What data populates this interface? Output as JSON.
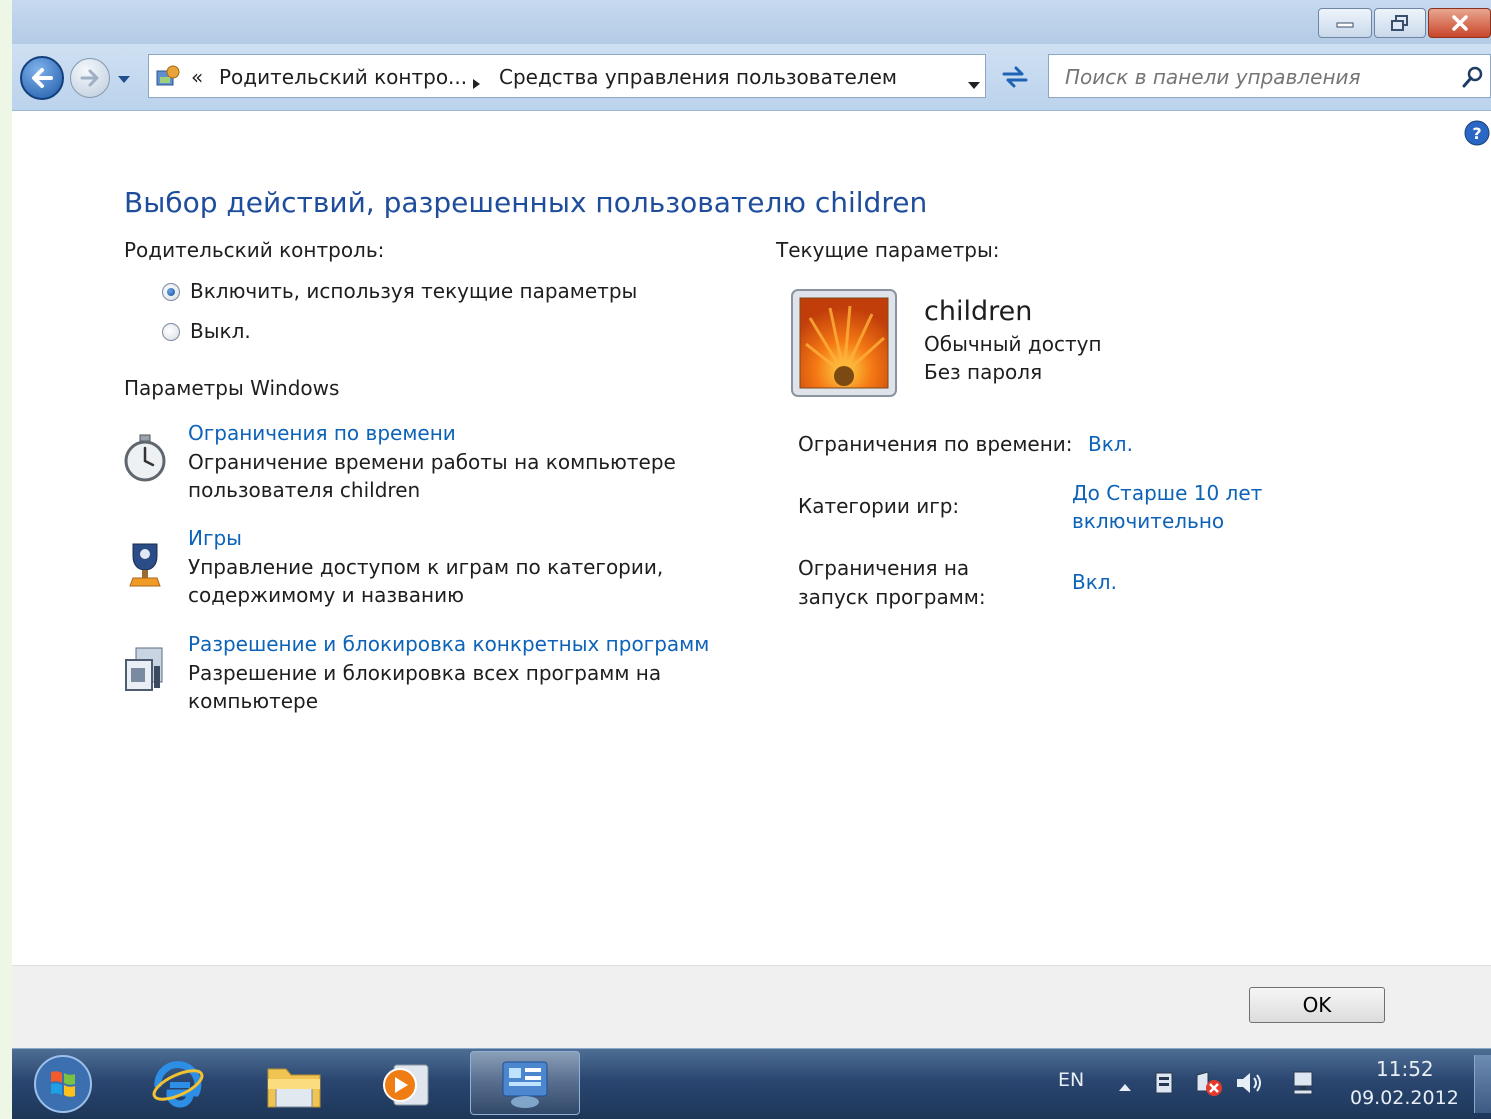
{
  "window": {
    "controls": {
      "minimize": "minimize",
      "maximize": "maximize",
      "close": "close"
    }
  },
  "nav": {
    "breadcrumb_prefix": "«",
    "breadcrumb_parent": "Родительский контро...",
    "breadcrumb_current": "Средства управления пользователем",
    "search_placeholder": "Поиск в панели управления"
  },
  "content": {
    "heading": "Выбор действий, разрешенных пользователю children",
    "parental_label": "Родительский контроль:",
    "radio_on_label": "Включить, используя текущие параметры",
    "radio_off_label": "Выкл.",
    "radio_selected": "on",
    "windows_params_label": "Параметры Windows",
    "items": [
      {
        "title": "Ограничения по времени",
        "desc1": "Ограничение времени работы на компьютере",
        "desc2": "пользователя children",
        "icon": "stopwatch-icon"
      },
      {
        "title": "Игры",
        "desc1": "Управление доступом к играм по категории,",
        "desc2": "содержимому и названию",
        "icon": "trophy-icon"
      },
      {
        "title": "Разрешение и блокировка конкретных программ",
        "desc1": "Разрешение и блокировка всех программ на",
        "desc2": "компьютере",
        "icon": "program-block-icon"
      }
    ]
  },
  "current": {
    "label": "Текущие параметры:",
    "user_name": "children",
    "account_type": "Обычный доступ",
    "password_status": "Без пароля",
    "time_limits_label": "Ограничения по времени:",
    "time_limits_value": "Вкл.",
    "games_label": "Категории игр:",
    "games_value_line1": "До Старше 10 лет",
    "games_value_line2": "включительно",
    "programs_label_line1": "Ограничения на",
    "programs_label_line2": "запуск программ:",
    "programs_value": "Вкл."
  },
  "footer": {
    "ok_label": "OK"
  },
  "taskbar": {
    "language": "EN",
    "time": "11:52",
    "date": "09.02.2012"
  },
  "colors": {
    "heading": "#1e4d9c",
    "link": "#0d63b8",
    "taskbar": "#2a4670"
  }
}
